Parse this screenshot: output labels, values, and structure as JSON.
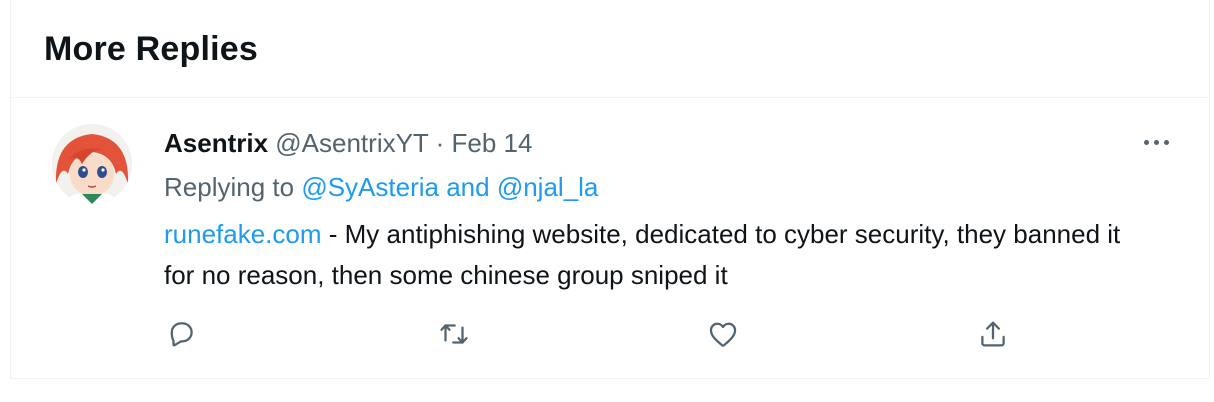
{
  "section": {
    "title": "More Replies"
  },
  "tweet": {
    "author_name": "Asentrix",
    "author_handle": "@AsentrixYT",
    "separator": "·",
    "date": "Feb 14",
    "replying_prefix": "Replying to",
    "replying_mention_1": "@SyAsteria",
    "replying_and": "and",
    "replying_mention_2": "@njal_la",
    "link_text": "runefake.com",
    "body_text": " - My antiphishing website, dedicated to cyber security, they banned it for no reason, then some chinese group sniped it"
  },
  "icons": {
    "more": "more-horizontal-icon",
    "reply": "reply-icon",
    "retweet": "retweet-icon",
    "like": "heart-icon",
    "share": "share-icon"
  },
  "colors": {
    "text": "#0f1419",
    "secondary": "#536471",
    "link": "#1d9bf0",
    "divider": "#eff3f4"
  }
}
